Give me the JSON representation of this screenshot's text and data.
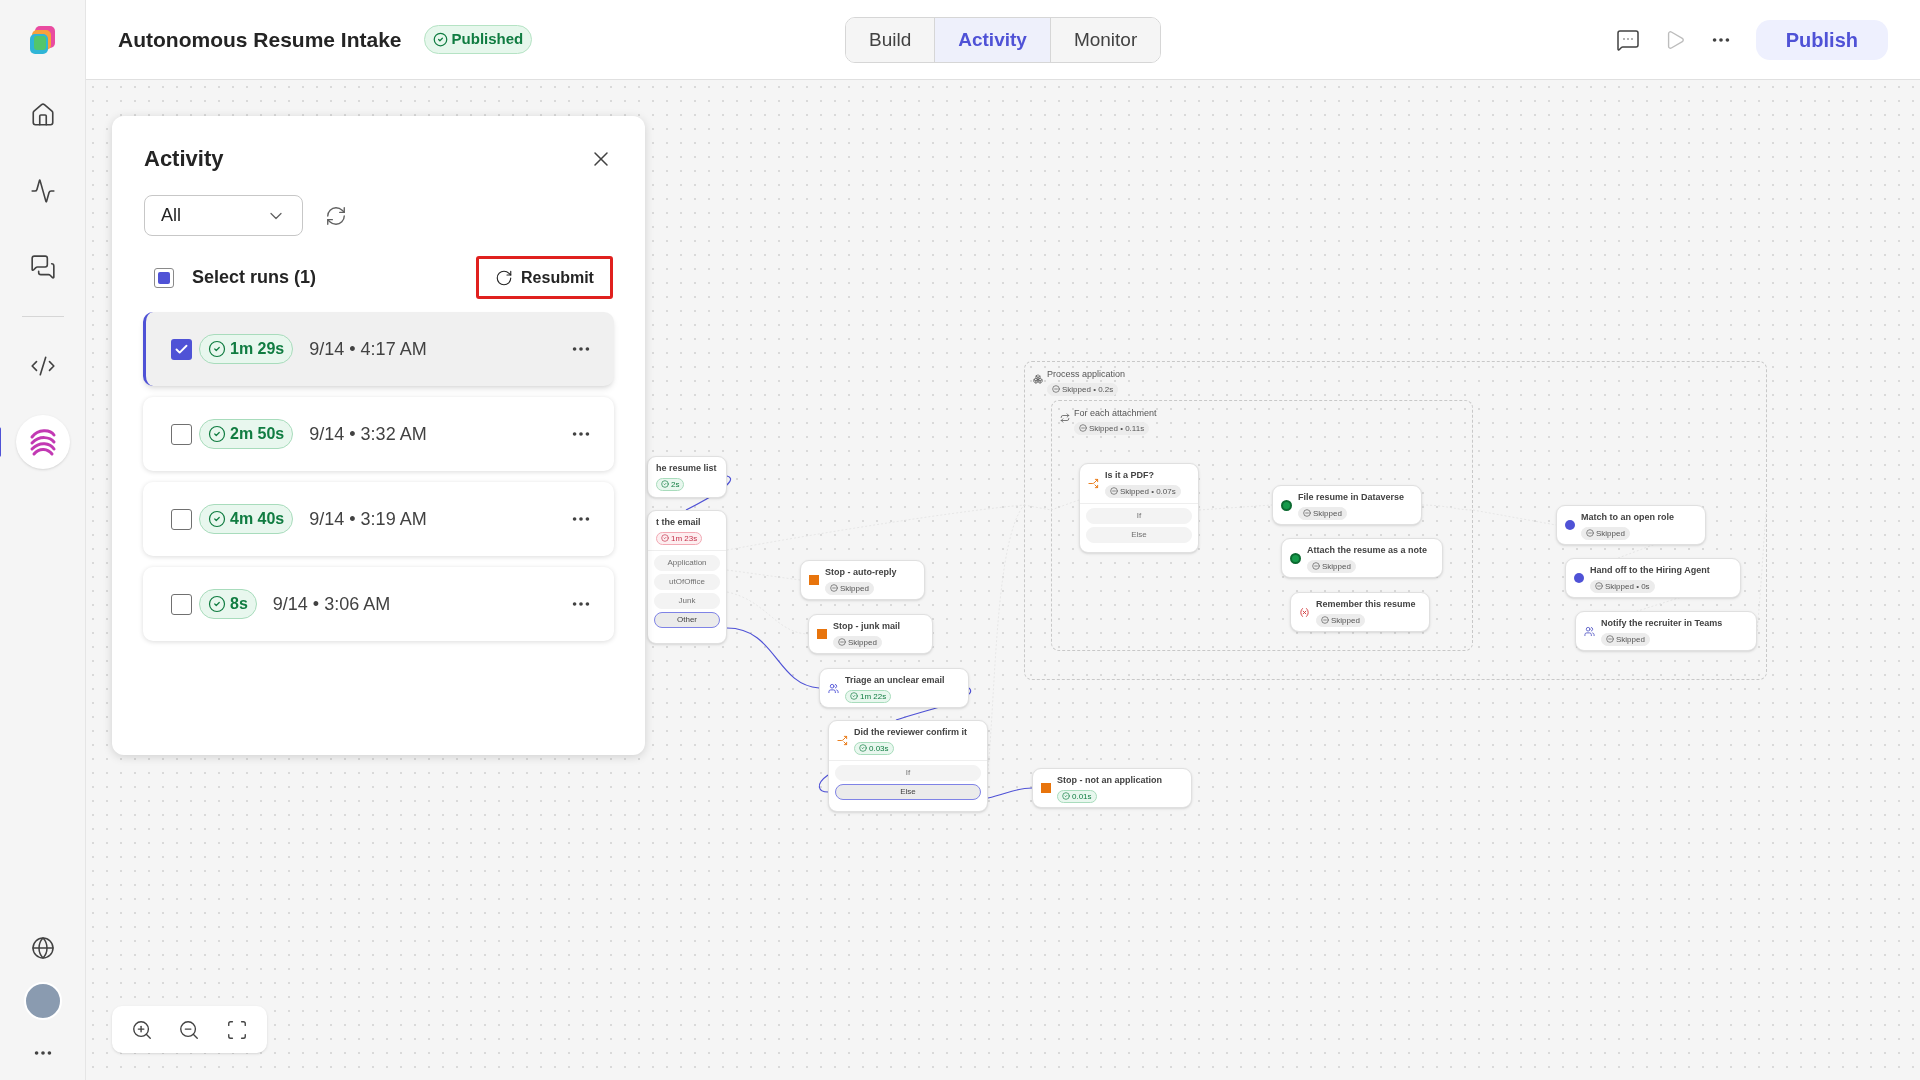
{
  "header": {
    "title": "Autonomous Resume Intake",
    "status": {
      "kind": "published",
      "label": "Published"
    },
    "tabs": [
      {
        "label": "Build",
        "selected": false
      },
      {
        "label": "Activity",
        "selected": true
      },
      {
        "label": "Monitor",
        "selected": false
      }
    ],
    "publish_button": "Publish"
  },
  "sidebar": {
    "items": [
      {
        "kind": "home",
        "selected": false
      },
      {
        "kind": "activity",
        "selected": false
      },
      {
        "kind": "chat",
        "selected": false
      },
      {
        "kind": "code",
        "selected": false
      },
      {
        "kind": "agent",
        "selected": true
      }
    ]
  },
  "activity_panel": {
    "title": "Activity",
    "filter": {
      "value": "All"
    },
    "select_runs": {
      "label": "Select runs (1)",
      "checked": false,
      "indeterminate": true
    },
    "resubmit_button": "Resubmit",
    "runs": [
      {
        "checked": true,
        "selected": true,
        "badge": {
          "kind": "success",
          "label": "1m 29s"
        },
        "time": "9/14 • 4:17 AM"
      },
      {
        "checked": false,
        "selected": false,
        "badge": {
          "kind": "success",
          "label": "2m 50s"
        },
        "time": "9/14 • 3:32 AM"
      },
      {
        "checked": false,
        "selected": false,
        "badge": {
          "kind": "success",
          "label": "4m 40s"
        },
        "time": "9/14 • 3:19 AM"
      },
      {
        "checked": false,
        "selected": false,
        "badge": {
          "kind": "success",
          "label": "8s"
        },
        "time": "9/14 • 3:06 AM"
      }
    ]
  },
  "canvas": {
    "nodes": [
      {
        "title": "he resume list",
        "badge": {
          "kind": "success",
          "label": "2s"
        }
      },
      {
        "title": "t the email",
        "badge": {
          "kind": "error",
          "label": "1m 23s"
        },
        "branches": [
          {
            "label": "Application",
            "selected": false
          },
          {
            "label": "utOfOffice",
            "selected": false
          },
          {
            "label": "Junk",
            "selected": false
          },
          {
            "label": "Other",
            "selected": true
          }
        ]
      },
      {
        "title": "Stop - auto-reply",
        "badge": {
          "kind": "skipped",
          "label": "Skipped"
        }
      },
      {
        "title": "Stop - junk mail",
        "badge": {
          "kind": "skipped",
          "label": "Skipped"
        }
      },
      {
        "title": "Triage an unclear email",
        "badge": {
          "kind": "success",
          "label": "1m 22s"
        }
      },
      {
        "title": "Did the reviewer confirm it",
        "badge": {
          "kind": "success",
          "label": "0.03s"
        },
        "branches": [
          {
            "label": "If",
            "selected": false
          },
          {
            "label": "Else",
            "selected": true
          }
        ]
      },
      {
        "title": "Stop - not an application",
        "badge": {
          "kind": "success",
          "label": "0.01s"
        }
      }
    ],
    "process_group": {
      "title": "Process application",
      "badge": {
        "kind": "skipped",
        "label": "Skipped • 0.2s"
      },
      "loop_group": {
        "title": "For each attachment",
        "badge": {
          "kind": "skipped",
          "label": "Skipped • 0.11s"
        },
        "nodes": [
          {
            "title": "Is it a PDF?",
            "badge": {
              "kind": "skipped",
              "label": "Skipped • 0.07s"
            },
            "branches": [
              {
                "label": "If",
                "selected": false
              },
              {
                "label": "Else",
                "selected": false
              }
            ]
          },
          {
            "title": "File resume in Dataverse",
            "badge": {
              "kind": "skipped",
              "label": "Skipped"
            }
          },
          {
            "title": "Attach the resume as a note",
            "badge": {
              "kind": "skipped",
              "label": "Skipped"
            }
          },
          {
            "title": "Remember this resume",
            "badge": {
              "kind": "skipped",
              "label": "Skipped"
            }
          }
        ]
      },
      "nodes": [
        {
          "title": "Match to an open role",
          "badge": {
            "kind": "skipped",
            "label": "Skipped"
          }
        },
        {
          "title": "Hand off to the Hiring Agent",
          "badge": {
            "kind": "skipped",
            "label": "Skipped • 0s"
          }
        },
        {
          "title": "Notify the recruiter in Teams",
          "badge": {
            "kind": "skipped",
            "label": "Skipped"
          }
        }
      ]
    }
  }
}
